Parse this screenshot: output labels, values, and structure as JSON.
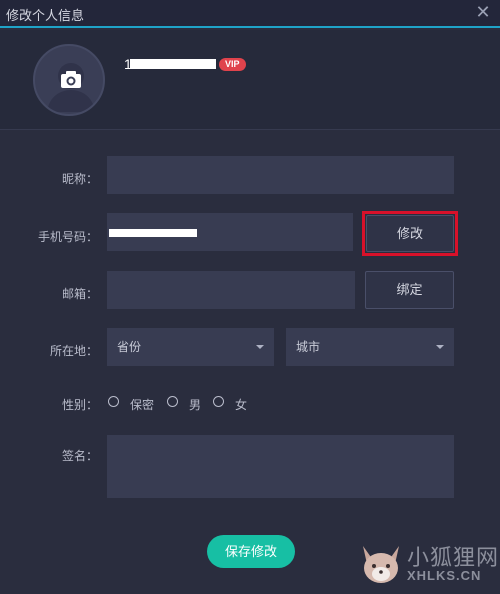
{
  "window": {
    "title": "修改个人信息"
  },
  "profile": {
    "username": "1",
    "vip": "VIP"
  },
  "form": {
    "nickname_label": "昵称：",
    "nickname_value": "",
    "phone_label": "手机号码：",
    "phone_edit_button": "修改",
    "email_label": "邮箱：",
    "email_value": "",
    "email_bind_button": "绑定",
    "location_label": "所在地：",
    "province_selected": "省份",
    "city_selected": "城市",
    "gender_label": "性别：",
    "gender_options": [
      "保密",
      "男",
      "女"
    ],
    "signature_label": "签名：",
    "signature_value": ""
  },
  "footer": {
    "save_button": "保存修改"
  },
  "watermark": {
    "cn": "小狐狸网",
    "en": "XHLKS.CN"
  },
  "colors": {
    "accent": "#17bfa4",
    "highlight": "#d8112a",
    "vip": "#e0434c",
    "topline": "#1fa3c8"
  }
}
